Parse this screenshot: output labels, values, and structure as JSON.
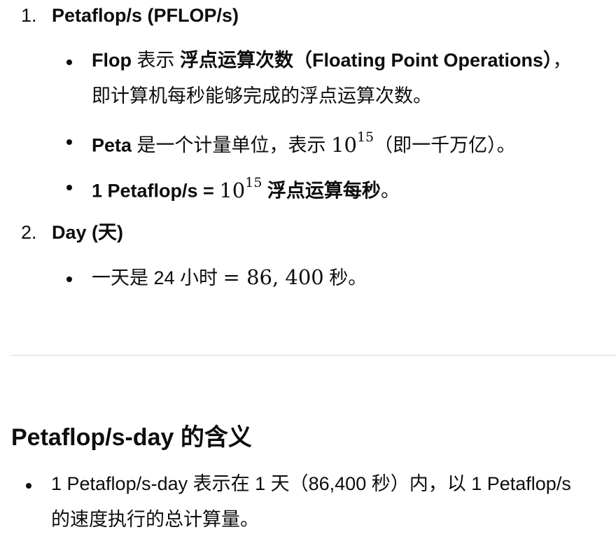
{
  "list": {
    "item1": {
      "number": "1.",
      "title": "Petaflop/s (PFLOP/s)",
      "bullets": {
        "b1": {
          "term": "Flop",
          "text1": " 表示 ",
          "bold": "浮点运算次数（Floating Point Operations）",
          "text2": "，",
          "line2": "即计算机每秒能够完成的浮点运算次数。"
        },
        "b2": {
          "term": "Peta",
          "text1": " 是一个计量单位，表示 ",
          "math_base": "10",
          "math_exp": "15",
          "text2": "（即一千万亿）。"
        },
        "b3": {
          "bold1": "1 Petaflop/s = ",
          "math_base": "10",
          "math_exp": "15",
          "bold2": " 浮点运算每秒",
          "text2": "。"
        }
      }
    },
    "item2": {
      "number": "2.",
      "title": "Day (天)",
      "bullets": {
        "b1": {
          "text1": "一天是 24 小时 ",
          "math": "= 86, 400",
          "text2": " 秒。"
        }
      }
    }
  },
  "section": {
    "heading": "Petaflop/s-day 的含义",
    "bullet": {
      "line1": "1 Petaflop/s-day 表示在 1 天（86,400 秒）内，以 1 Petaflop/s",
      "line2": "的速度执行的总计算量。"
    }
  }
}
